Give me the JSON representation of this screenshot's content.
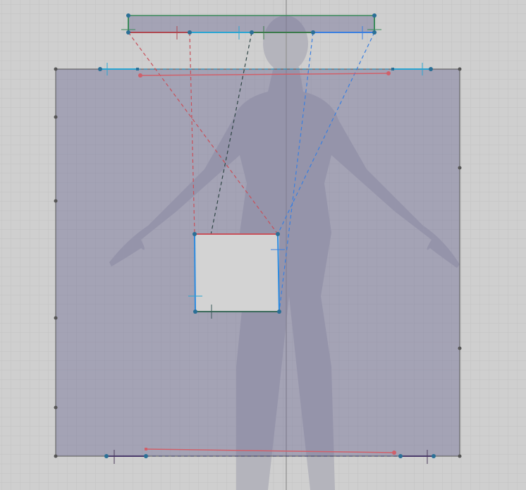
{
  "colors": {
    "background": "#cfcfcf",
    "grid": "#c3c3c3",
    "piece_fill": "#8e8ca8",
    "point": "#2a6f96",
    "red": "#c8505a",
    "cyan": "#2aa6d2",
    "green": "#3a8a5a",
    "blue": "#3a7fe0",
    "dark": "#3a4a4a",
    "silhouette": "#a9a9b4"
  }
}
